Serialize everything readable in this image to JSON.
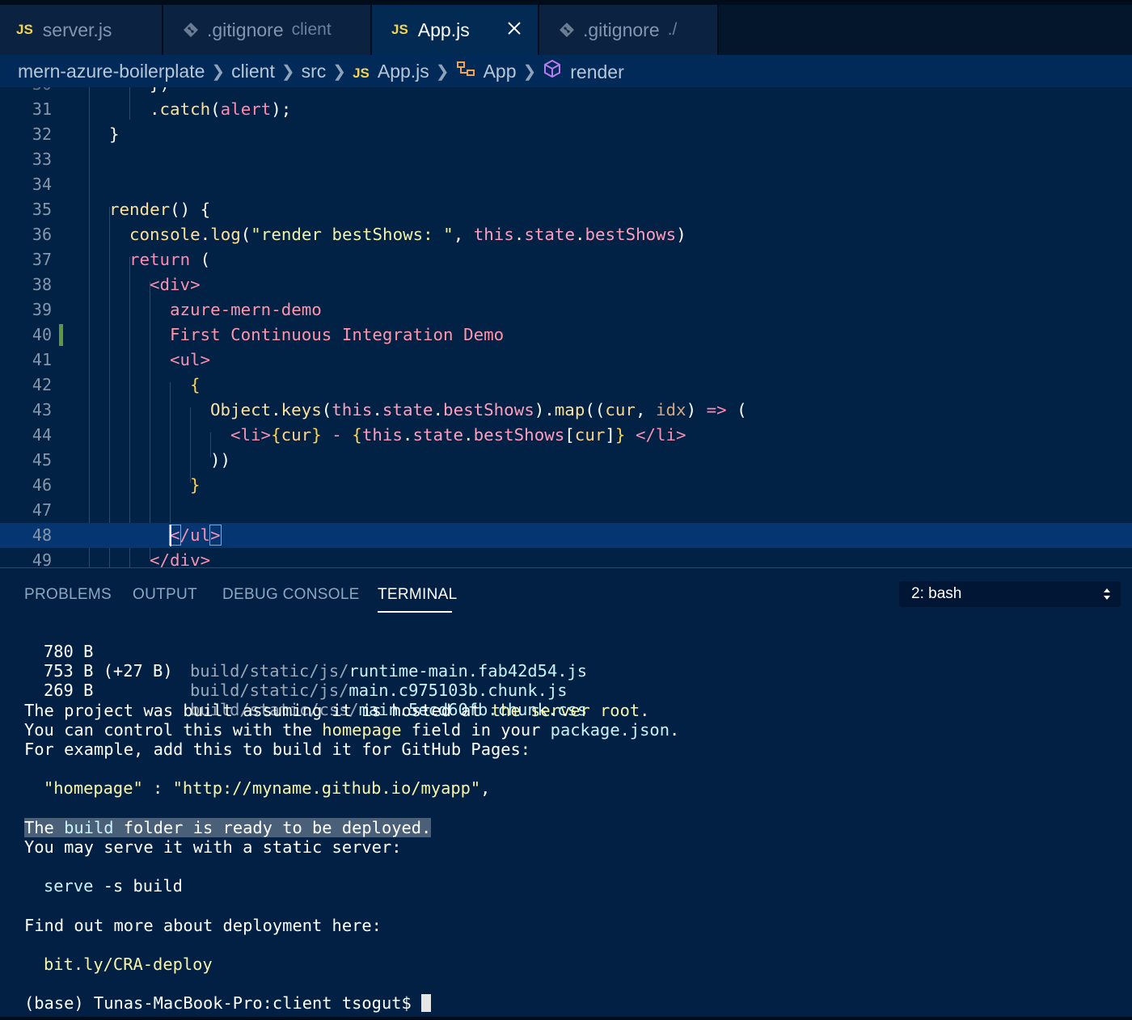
{
  "tabs": [
    {
      "label": "server.js",
      "badge": "JS"
    },
    {
      "label": ".gitignore",
      "hint": "client"
    },
    {
      "label": "App.js",
      "badge": "JS",
      "active": true
    },
    {
      "label": ".gitignore",
      "hint": "./"
    }
  ],
  "breadcrumb": [
    "mern-azure-boilerplate",
    "client",
    "src",
    "App.js",
    "App",
    "render"
  ],
  "editor": {
    "line_numbers": [
      "31",
      "32",
      "33",
      "34",
      "35",
      "36",
      "37",
      "38",
      "39",
      "40",
      "41",
      "42",
      "43",
      "44",
      "45",
      "46",
      "47",
      "48",
      "49"
    ],
    "code": {
      "l31": [
        ".",
        "catch",
        "(",
        "alert",
        ");"
      ],
      "l32": [
        "}"
      ],
      "l35": [
        "render",
        "() {"
      ],
      "l36": [
        "console",
        ".",
        "log",
        "(",
        "\"render bestShows: \"",
        ", ",
        "this",
        ".",
        "state",
        ".",
        "bestShows",
        ")"
      ],
      "l37": [
        "return",
        " ("
      ],
      "l38": [
        "<div>"
      ],
      "l39": [
        "azure-mern-demo"
      ],
      "l40": [
        "First Continuous Integration Demo"
      ],
      "l41": [
        "<ul>"
      ],
      "l42": [
        "{"
      ],
      "l43": [
        "Object",
        ".",
        "keys",
        "(",
        "this",
        ".",
        "state",
        ".",
        "bestShows",
        ").",
        "map",
        "((",
        "cur",
        ", ",
        "idx",
        ") ",
        "=>",
        " ("
      ],
      "l44": [
        "<li>",
        "{",
        "cur",
        "}",
        " - ",
        "{",
        "this",
        ".",
        "state",
        ".",
        "bestShows",
        "[",
        "cur",
        "]",
        "}",
        " ",
        "</li>"
      ],
      "l45": [
        "))"
      ],
      "l46": [
        "}"
      ],
      "l48": [
        "<",
        "/ul",
        ">"
      ],
      "l49": [
        "</div>"
      ]
    }
  },
  "panel": {
    "tabs": [
      "PROBLEMS",
      "OUTPUT",
      "DEBUG CONSOLE",
      "TERMINAL"
    ],
    "active_tab": "TERMINAL",
    "terminal_select": "2: bash",
    "terminal": {
      "f1": {
        "size": "780 B",
        "dir": "build/static/js/",
        "file": "runtime-main.fab42d54.js"
      },
      "f2": {
        "size": "753 B (+27 B)",
        "dir": "build/static/js/",
        "file": "main.c975103b.chunk.js"
      },
      "f3": {
        "size": "269 B",
        "dir": "build/static/css/",
        "file": "main.5ecd60fb.chunk.css"
      },
      "p1a": "The project was built assuming it is hosted at ",
      "p1b": "the server root",
      "p1c": ".",
      "p2a": "You can control this with the ",
      "p2b": "homepage",
      "p2c": " field in your ",
      "p2d": "package.json",
      "p2e": ".",
      "p3": "For example, add this to build it for GitHub Pages:",
      "hp_key": "\"homepage\"",
      "hp_sep": " : ",
      "hp_val": "\"http://myname.github.io/myapp\"",
      "hp_comma": ",",
      "r1a": "The ",
      "r1b": "build",
      "r1c": " folder is ready to be deployed.",
      "r2": "You may serve it with a static server:",
      "serve_cmd": "serve",
      "serve_args": " -s build",
      "more": "Find out more about deployment here:",
      "link": "bit.ly/CRA-deploy",
      "prompt": "(base) Tunas-MacBook-Pro:client tsogut$ "
    }
  },
  "colors": {
    "background": "#011e3f",
    "accent_js": "#f5d452",
    "modified_gutter": "#5d9a3d"
  }
}
